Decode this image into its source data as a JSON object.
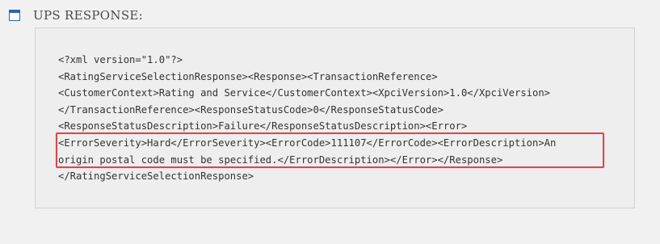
{
  "section": {
    "icon": "window-icon",
    "title": "UPS RESPONSE:"
  },
  "response": {
    "lines": [
      "<?xml version=\"1.0\"?>",
      "<RatingServiceSelectionResponse><Response><TransactionReference>",
      "<CustomerContext>Rating and Service</CustomerContext><XpciVersion>1.0</XpciVersion>",
      "</TransactionReference><ResponseStatusCode>0</ResponseStatusCode>",
      "<ResponseStatusDescription>Failure</ResponseStatusDescription><Error>",
      "<ErrorSeverity>Hard</ErrorSeverity><ErrorCode>111107</ErrorCode><ErrorDescription>An",
      "origin postal code must be specified.</ErrorDescription></Error></Response>",
      "</RatingServiceSelectionResponse>"
    ]
  },
  "colors": {
    "background": "#f1f1f1",
    "panel": "#eeeeee",
    "icon_accent": "#2a67b1",
    "highlight": "#e0454a"
  }
}
